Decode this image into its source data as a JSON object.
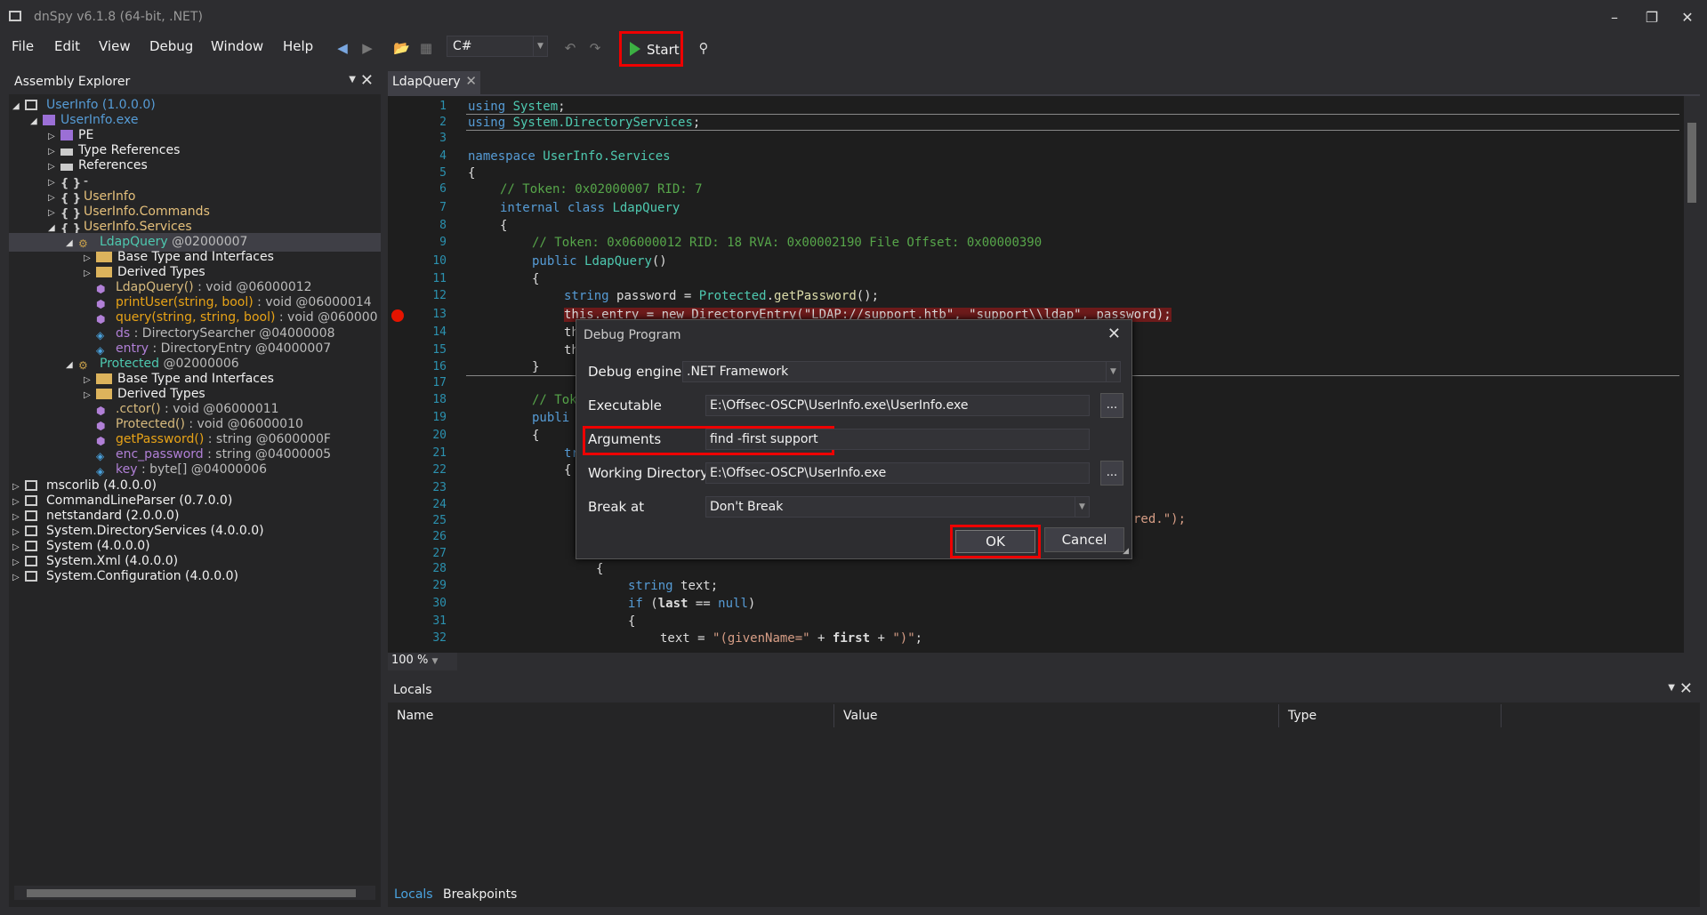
{
  "window": {
    "title": "dnSpy v6.1.8 (64-bit, .NET)"
  },
  "menu": [
    "File",
    "Edit",
    "View",
    "Debug",
    "Window",
    "Help"
  ],
  "toolbar": {
    "language": "C#",
    "start_label": "Start"
  },
  "explorer": {
    "title": "Assembly Explorer",
    "tree": [
      {
        "label": "UserInfo (1.0.0.0)",
        "color": "#569cd6",
        "icon": "assembly-icon"
      },
      {
        "label": "UserInfo.exe",
        "color": "#569cd6",
        "icon": "module-icon"
      },
      {
        "label": "PE",
        "color": "#f1f1f1",
        "icon": "pe-icon"
      },
      {
        "label": "Type References",
        "color": "#f1f1f1",
        "icon": "references-icon"
      },
      {
        "label": "References",
        "color": "#f1f1f1",
        "icon": "references-icon"
      },
      {
        "label": "-",
        "color": "#f1f1f1",
        "icon": "namespace-icon"
      },
      {
        "label": "UserInfo",
        "color": "#e5c07b",
        "icon": "namespace-icon"
      },
      {
        "label": "UserInfo.Commands",
        "color": "#e5c07b",
        "icon": "namespace-icon"
      },
      {
        "label": "UserInfo.Services",
        "color": "#e5c07b",
        "icon": "namespace-icon"
      },
      {
        "label": "LdapQuery",
        "suffix": " @02000007",
        "color": "#4ec9b0",
        "icon": "class-icon"
      },
      {
        "label": "Base Type and Interfaces",
        "color": "#f1f1f1",
        "icon": "folder-icon"
      },
      {
        "label": "Derived Types",
        "color": "#f1f1f1",
        "icon": "folder-icon"
      },
      {
        "label": "LdapQuery()",
        "suffix": " : void @06000012",
        "color": "#d7ba7d",
        "icon": "method-icon"
      },
      {
        "label": "printUser(string, bool)",
        "suffix": " : void @06000014",
        "color": "#e8a317",
        "icon": "method-icon"
      },
      {
        "label": "query(string, string, bool)",
        "suffix": " : void @060000",
        "color": "#e8a317",
        "icon": "method-icon"
      },
      {
        "label": "ds",
        "suffix": " : DirectorySearcher @04000008",
        "color": "#b180d7",
        "icon": "field-icon"
      },
      {
        "label": "entry",
        "suffix": " : DirectoryEntry @04000007",
        "color": "#b180d7",
        "icon": "field-icon"
      },
      {
        "label": "Protected",
        "suffix": " @02000006",
        "color": "#4ec9b0",
        "icon": "class-icon"
      },
      {
        "label": "Base Type and Interfaces",
        "color": "#f1f1f1",
        "icon": "folder-icon"
      },
      {
        "label": "Derived Types",
        "color": "#f1f1f1",
        "icon": "folder-icon"
      },
      {
        "label": ".cctor()",
        "suffix": " : void @06000011",
        "color": "#d7ba7d",
        "icon": "method-icon"
      },
      {
        "label": "Protected()",
        "suffix": " : void @06000010",
        "color": "#d7ba7d",
        "icon": "method-icon"
      },
      {
        "label": "getPassword()",
        "suffix": " : string @0600000F",
        "color": "#e8a317",
        "icon": "method-icon"
      },
      {
        "label": "enc_password",
        "suffix": " : string @04000005",
        "color": "#b180d7",
        "icon": "field-icon"
      },
      {
        "label": "key",
        "suffix": " : byte[] @04000006",
        "color": "#b180d7",
        "icon": "field-icon"
      },
      {
        "label": "mscorlib (4.0.0.0)",
        "color": "#f1f1f1",
        "icon": "assembly-icon"
      },
      {
        "label": "CommandLineParser (0.7.0.0)",
        "color": "#f1f1f1",
        "icon": "assembly-icon"
      },
      {
        "label": "netstandard (2.0.0.0)",
        "color": "#f1f1f1",
        "icon": "assembly-icon"
      },
      {
        "label": "System.DirectoryServices (4.0.0.0)",
        "color": "#f1f1f1",
        "icon": "assembly-icon"
      },
      {
        "label": "System (4.0.0.0)",
        "color": "#f1f1f1",
        "icon": "assembly-icon"
      },
      {
        "label": "System.Xml (4.0.0.0)",
        "color": "#f1f1f1",
        "icon": "assembly-icon"
      },
      {
        "label": "System.Configuration (4.0.0.0)",
        "color": "#f1f1f1",
        "icon": "assembly-icon"
      }
    ]
  },
  "editor": {
    "tab": "LdapQuery",
    "zoom": "100 %",
    "line_numbers": [
      "1",
      "2",
      "3",
      "4",
      "5",
      "6",
      "7",
      "8",
      "9",
      "10",
      "11",
      "12",
      "13",
      "14",
      "15",
      "16",
      "17",
      "18",
      "19",
      "20",
      "21",
      "22",
      "23",
      "24",
      "25",
      "26",
      "27",
      "28",
      "29",
      "30",
      "31",
      "32"
    ]
  },
  "code": {
    "l1": "using System;",
    "l2": "using System.DirectoryServices;",
    "l4a": "namespace ",
    "l4b": "UserInfo.Services",
    "l5": "{",
    "l6": "// Token: 0x02000007 RID: 7",
    "l7a": "internal class ",
    "l7b": "LdapQuery",
    "l8": "{",
    "l9": "// Token: 0x06000012 RID: 18 RVA: 0x00002190 File Offset: 0x00000390",
    "l10a": "public ",
    "l10b": "LdapQuery",
    "l10c": "()",
    "l11": "{",
    "l12a": "string ",
    "l12b": "password = ",
    "l12c": "Protected",
    "l12d": ".",
    "l12e": "getPassword",
    "l12f": "();",
    "l13": "this.entry = new DirectoryEntry(\"LDAP://support.htb\", \"support\\\\ldap\", password);",
    "l14": "th",
    "l15": "th",
    "l16": "}",
    "l18": "// Tok",
    "l19": "publi",
    "l20": "{",
    "l21": "tr",
    "l22": "{",
    "l25": "red.\");",
    "l28": "{",
    "l29a": "string ",
    "l29b": "text;",
    "l30a": "if ",
    "l30b": "(",
    "l30c": "last",
    "l30d": " == ",
    "l30e": "null",
    "l30f": ")",
    "l31": "{",
    "l32a": "text = ",
    "l32b": "\"(givenName=\"",
    "l32c": " + ",
    "l32d": "first",
    "l32e": " + ",
    "l32f": "\")\"",
    "l32g": ";"
  },
  "locals": {
    "title": "Locals",
    "columns": [
      "Name",
      "Value",
      "Type"
    ],
    "tabs": [
      "Locals",
      "Breakpoints"
    ]
  },
  "dialog": {
    "title": "Debug Program",
    "engine_label": "Debug engine",
    "engine_value": ".NET Framework",
    "exe_label": "Executable",
    "exe_value": "E:\\Offsec-OSCP\\UserInfo.exe\\UserInfo.exe",
    "args_label": "Arguments",
    "args_value": "find -first support",
    "wd_label": "Working Directory",
    "wd_value": "E:\\Offsec-OSCP\\UserInfo.exe",
    "break_label": "Break at",
    "break_value": "Don't Break",
    "browse": "...",
    "ok": "OK",
    "cancel": "Cancel"
  }
}
